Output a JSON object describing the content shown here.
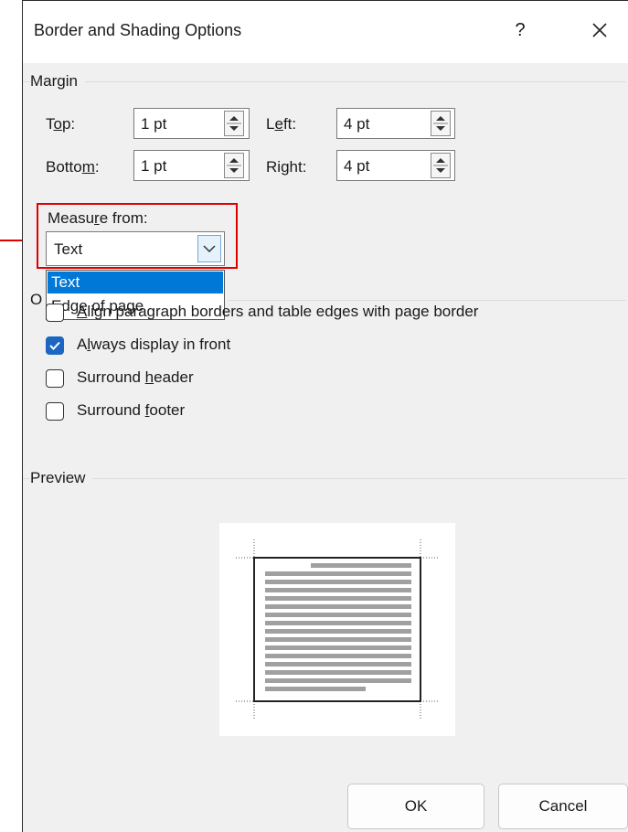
{
  "dialog": {
    "title": "Border and Shading Options",
    "help_label": "?"
  },
  "margin": {
    "group_label": "Margin",
    "top_label": "Top:",
    "top_value": "1 pt",
    "bottom_label": "Bottom:",
    "bottom_value": "1 pt",
    "left_label": "Left:",
    "left_value": "4 pt",
    "right_label": "Right:",
    "right_value": "4 pt"
  },
  "measure_from": {
    "label": "Measure from:",
    "value": "Text",
    "options": [
      "Text",
      "Edge of page"
    ]
  },
  "options": {
    "group_label": "O",
    "items": [
      {
        "label": "Align paragraph borders and table edges with page border",
        "checked": false
      },
      {
        "label": "Always display in front",
        "checked": true
      },
      {
        "label": "Surround header",
        "checked": false
      },
      {
        "label": "Surround footer",
        "checked": false
      }
    ]
  },
  "preview": {
    "group_label": "Preview"
  },
  "buttons": {
    "ok": "OK",
    "cancel": "Cancel"
  },
  "colors": {
    "highlight": "#e00000",
    "accent": "#0078d7"
  }
}
